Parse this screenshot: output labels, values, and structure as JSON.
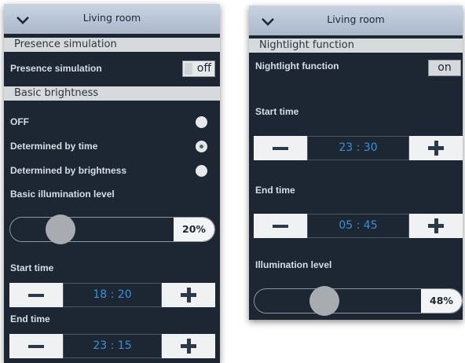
{
  "left": {
    "header_title": "Living room",
    "presence_section": "Presence simulation",
    "presence_label": "Presence simulation",
    "presence_toggle": "off",
    "brightness_section": "Basic brightness",
    "options": [
      {
        "label": "OFF",
        "checked": false
      },
      {
        "label": "Determined by time",
        "checked": true
      },
      {
        "label": "Determined by brightness",
        "checked": false
      }
    ],
    "illumination_label": "Basic illumination level",
    "illumination_value": "20%",
    "illumination_level": 0.2,
    "start_label": "Start time",
    "start_time": "18 : 20",
    "end_label": "End time",
    "end_time": "23 : 15"
  },
  "right": {
    "header_title": "Living room",
    "section": "Nightlight function",
    "function_label": "Nightlight function",
    "function_toggle": "on",
    "start_label": "Start time",
    "start_time": "23 : 30",
    "end_label": "End time",
    "end_time": "05 : 45",
    "illumination_label": "Illumination level",
    "illumination_value": "48%",
    "illumination_level": 0.48
  }
}
